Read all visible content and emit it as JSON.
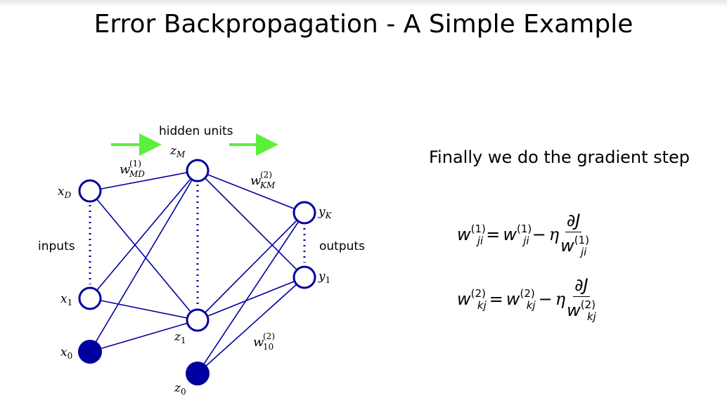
{
  "slide": {
    "title": "Error Backpropagation - A Simple Example",
    "caption": "Finally we do the gradient step"
  },
  "network": {
    "hidden_units_label": "hidden units",
    "inputs_label": "inputs",
    "outputs_label": "outputs",
    "node_labels": {
      "xD": "x",
      "xD_sub": "D",
      "x1": "x",
      "x1_sub": "1",
      "x0": "x",
      "x0_sub": "0",
      "zM": "z",
      "zM_sub": "M",
      "z1": "z",
      "z1_sub": "1",
      "z0": "z",
      "z0_sub": "0",
      "yK": "y",
      "yK_sub": "K",
      "y1": "y",
      "y1_sub": "1"
    },
    "weight_labels": {
      "wMD": "w",
      "wMD_sup": "(1)",
      "wMD_sub": "MD",
      "wKM": "w",
      "wKM_sup": "(2)",
      "wKM_sub": "KM",
      "w10": "w",
      "w10_sup": "(2)",
      "w10_sub": "10"
    },
    "colors": {
      "node": "#00009e",
      "edge": "#00009e",
      "arrow": "#5cf03c"
    }
  },
  "equations": [
    {
      "lhs": "w",
      "lhs_sup": "(1)",
      "lhs_sub": "ji",
      "eq": "=",
      "rhs": "w",
      "rhs_sup": "(1)",
      "rhs_sub": "ji",
      "minus": "−",
      "eta": "η",
      "num": "∂J",
      "den": "w",
      "den_sup": "(1)",
      "den_sub": "ji"
    },
    {
      "lhs": "w",
      "lhs_sup": "(2)",
      "lhs_sub": "kj",
      "eq": "=",
      "rhs": "w",
      "rhs_sup": "(2)",
      "rhs_sub": "kj",
      "minus": "−",
      "eta": "η",
      "num": "∂J",
      "den": "w",
      "den_sup": "(2)",
      "den_sub": "kj"
    }
  ]
}
